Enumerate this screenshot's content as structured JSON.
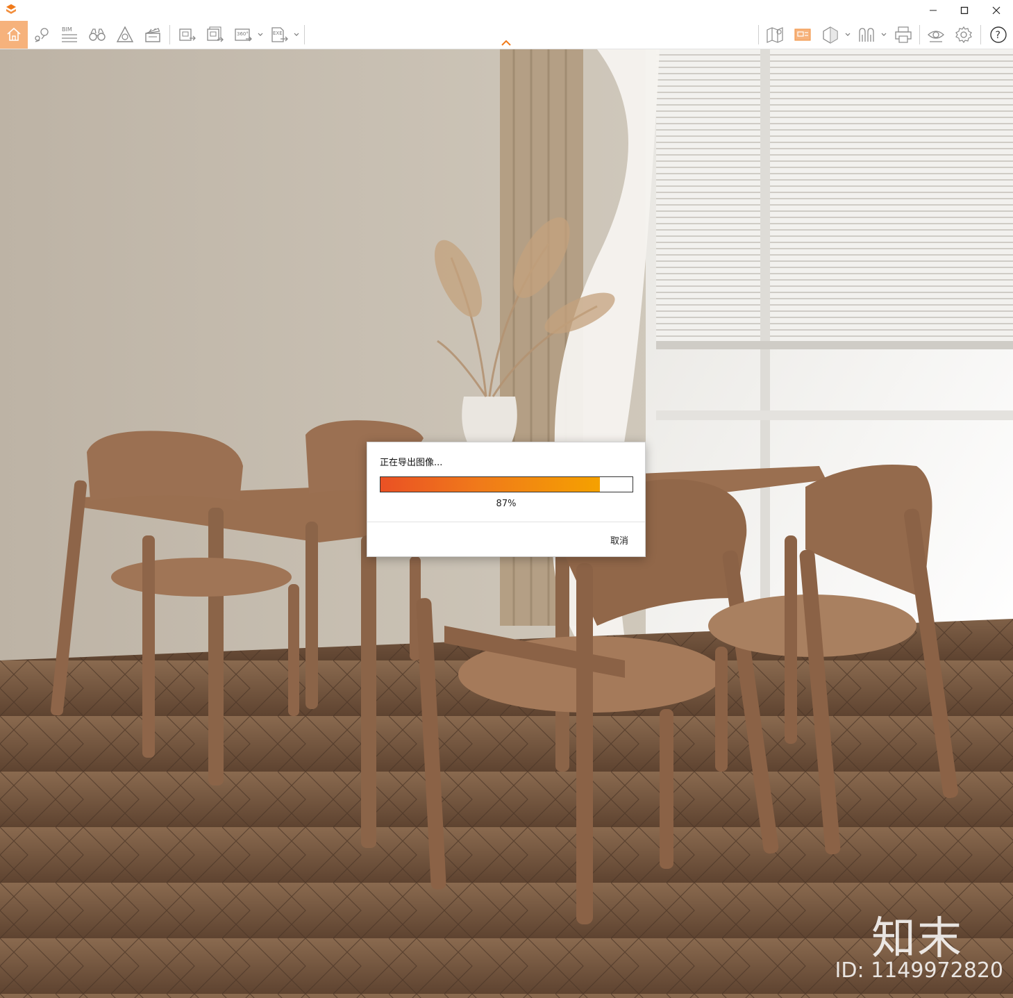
{
  "window": {
    "controls": [
      {
        "name": "minimize-button",
        "glyph": "—"
      },
      {
        "name": "maximize-button",
        "glyph": "☐"
      },
      {
        "name": "close-button",
        "glyph": "✕"
      }
    ]
  },
  "toolbar": {
    "left_tools": [
      {
        "name": "home-icon",
        "active": true
      },
      {
        "name": "location-pin-icon"
      },
      {
        "name": "bim-icon",
        "label": "BIM"
      },
      {
        "name": "binoculars-icon"
      },
      {
        "name": "warning-triangle-icon"
      },
      {
        "name": "clapperboard-icon"
      },
      {
        "name": "export-image-icon"
      },
      {
        "name": "export-batch-image-icon"
      },
      {
        "name": "export-panorama-icon",
        "label": "360°",
        "dropdown": true
      },
      {
        "name": "export-exe-icon",
        "label": "EXE",
        "dropdown": true
      }
    ],
    "right_tools": [
      {
        "name": "map-icon"
      },
      {
        "name": "image-panel-icon",
        "active": true
      },
      {
        "name": "cube-icon",
        "dropdown": true
      },
      {
        "name": "people-icon",
        "dropdown": true
      },
      {
        "name": "print-icon"
      },
      {
        "name": "eye-icon"
      },
      {
        "name": "gear-icon"
      },
      {
        "name": "help-icon",
        "label": "?"
      }
    ]
  },
  "dialog": {
    "title": "正在导出图像...",
    "progress_percent": 87,
    "progress_label": "87%",
    "cancel_label": "取消"
  },
  "watermark": {
    "logo_text": "知末",
    "id_text": "ID: 1149972820"
  },
  "colors": {
    "accent": "#f07a1a",
    "progress_start": "#ea5124",
    "progress_end": "#f5a100",
    "active_tool_bg": "#f6b27c"
  }
}
